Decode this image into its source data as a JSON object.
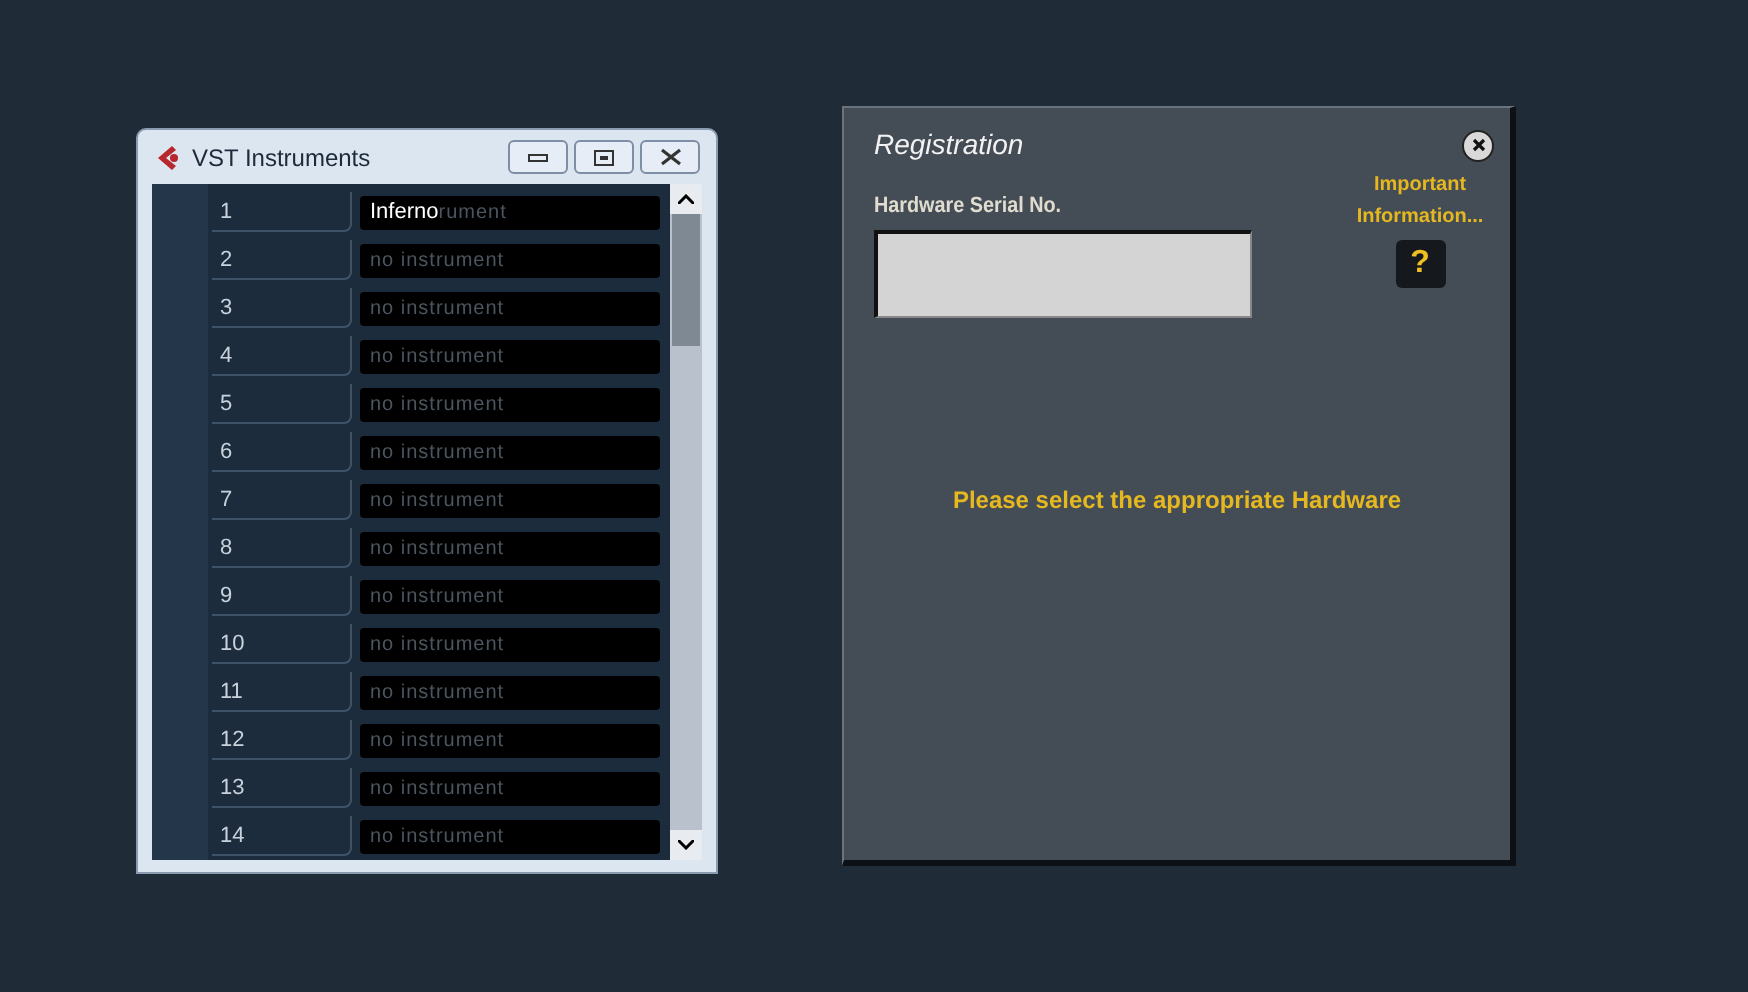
{
  "vst_window": {
    "title": "VST Instruments",
    "rows": [
      {
        "number": "1",
        "name": "Inferno",
        "behind": "rument",
        "loaded": true
      },
      {
        "number": "2",
        "name": "no instrument",
        "loaded": false
      },
      {
        "number": "3",
        "name": "no instrument",
        "loaded": false
      },
      {
        "number": "4",
        "name": "no instrument",
        "loaded": false
      },
      {
        "number": "5",
        "name": "no instrument",
        "loaded": false
      },
      {
        "number": "6",
        "name": "no instrument",
        "loaded": false
      },
      {
        "number": "7",
        "name": "no instrument",
        "loaded": false
      },
      {
        "number": "8",
        "name": "no instrument",
        "loaded": false
      },
      {
        "number": "9",
        "name": "no instrument",
        "loaded": false
      },
      {
        "number": "10",
        "name": "no instrument",
        "loaded": false
      },
      {
        "number": "11",
        "name": "no instrument",
        "loaded": false
      },
      {
        "number": "12",
        "name": "no instrument",
        "loaded": false
      },
      {
        "number": "13",
        "name": "no instrument",
        "loaded": false
      },
      {
        "number": "14",
        "name": "no instrument",
        "loaded": false
      }
    ]
  },
  "registration": {
    "title": "Registration",
    "serial_label": "Hardware Serial No.",
    "info_label": "Important Information...",
    "help_button": "?",
    "message": "Please select the appropriate Hardware"
  }
}
